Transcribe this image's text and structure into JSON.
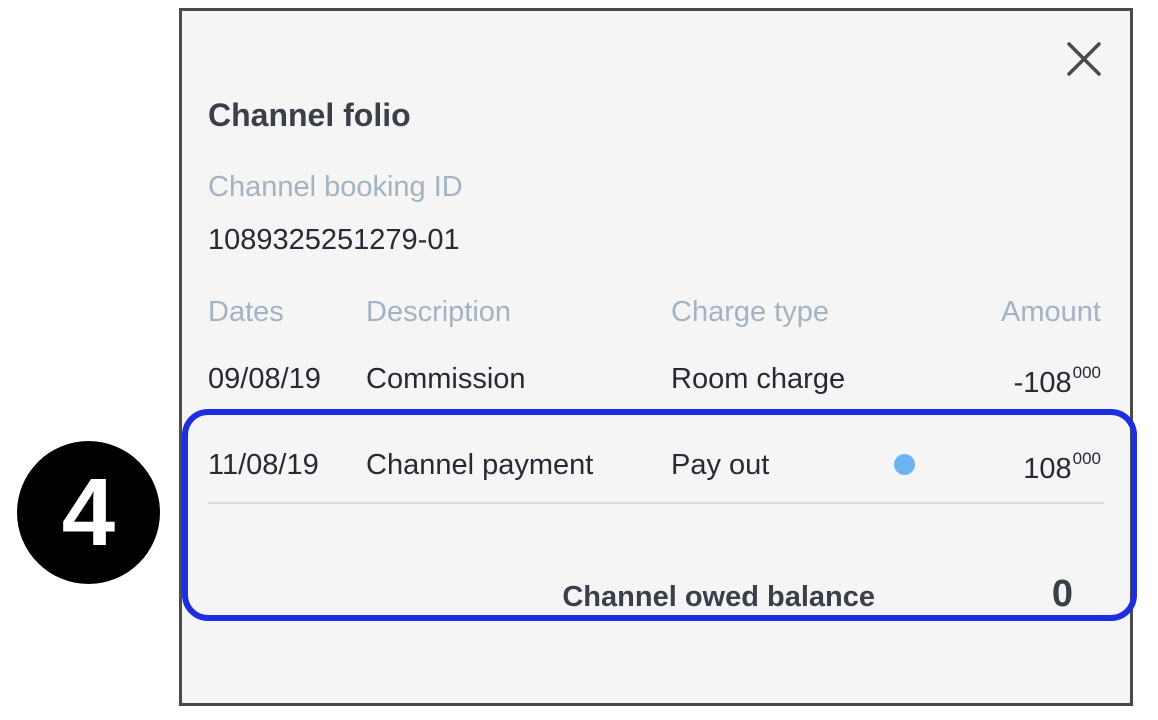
{
  "dialog": {
    "title": "Channel folio",
    "close_icon": "close-icon",
    "booking": {
      "label": "Channel booking ID",
      "value": "1089325251279-01"
    },
    "table": {
      "headers": [
        "Dates",
        "Description",
        "Charge type",
        "Amount"
      ],
      "rows": [
        {
          "date": "09/08/19",
          "description": "Commission",
          "charge_type": "Room charge",
          "amount_main": "-108",
          "amount_sup": "000",
          "indicator": false
        },
        {
          "date": "11/08/19",
          "description": "Channel payment",
          "charge_type": "Pay out",
          "amount_main": "108",
          "amount_sup": "000",
          "indicator": true
        }
      ]
    },
    "balance": {
      "label": "Channel owed balance",
      "value": "0"
    }
  },
  "annotation": {
    "step_number": "4",
    "highlight_color": "#1d2de0",
    "badge_color": "#000000"
  },
  "colors": {
    "indicator_dot": "#6fb4f2",
    "label_gray": "#a4b3c2",
    "text_dark": "#262a33"
  }
}
